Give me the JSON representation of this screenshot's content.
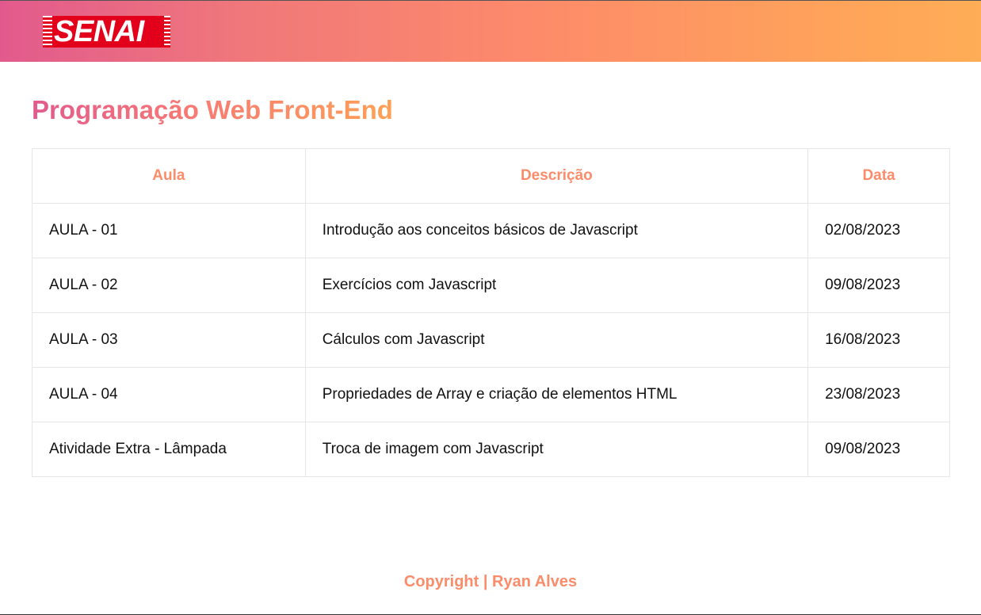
{
  "header": {
    "logo_text": "SENAI",
    "brand_color": "#e3001b",
    "gradient_start": "#e25a8d",
    "gradient_end": "#ffad56"
  },
  "page_title": "Programação Web Front-End",
  "table": {
    "columns": [
      "Aula",
      "Descrição",
      "Data"
    ],
    "rows": [
      {
        "aula": "AULA - 01",
        "descricao": "Introdução aos conceitos básicos de Javascript",
        "data": "02/08/2023"
      },
      {
        "aula": "AULA - 02",
        "descricao": "Exercícios com Javascript",
        "data": "09/08/2023"
      },
      {
        "aula": "AULA - 03",
        "descricao": "Cálculos com Javascript",
        "data": "16/08/2023"
      },
      {
        "aula": "AULA - 04",
        "descricao": "Propriedades de Array e criação de elementos HTML",
        "data": "23/08/2023"
      },
      {
        "aula": "Atividade Extra - Lâmpada",
        "descricao": "Troca de imagem com Javascript",
        "data": "09/08/2023"
      }
    ]
  },
  "footer": {
    "text": "Copyright | Ryan Alves"
  },
  "accent_color": "#fa8c6a"
}
